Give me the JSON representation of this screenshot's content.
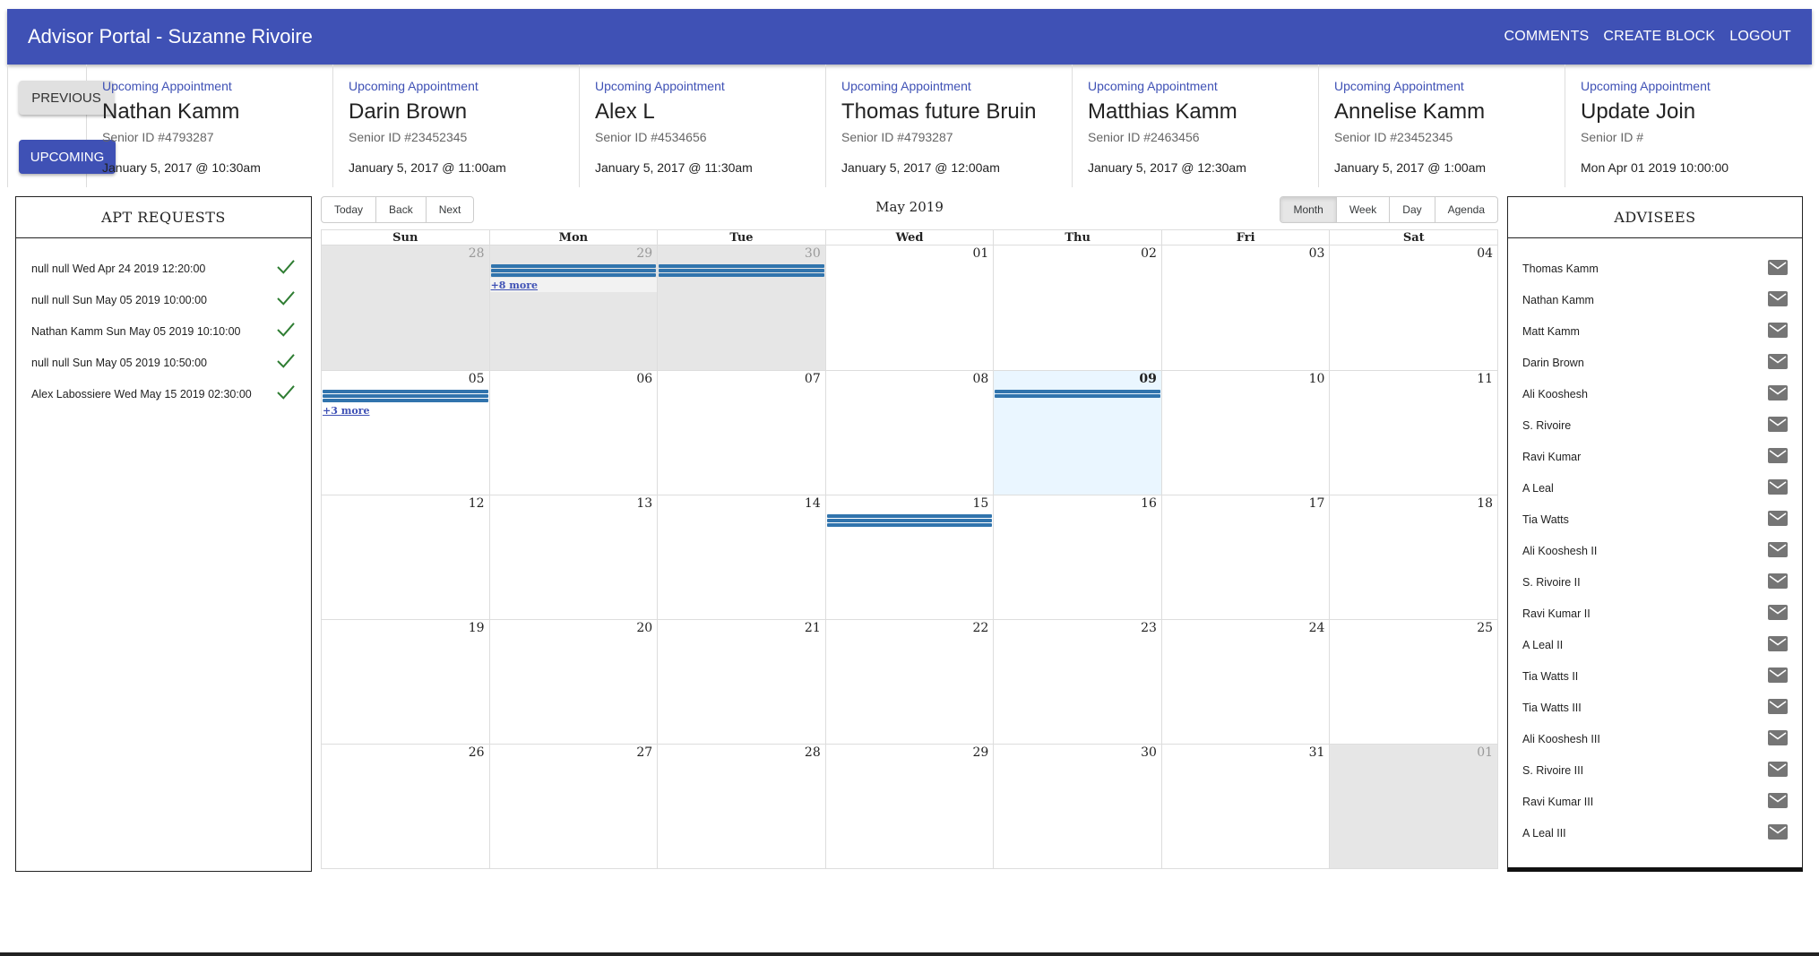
{
  "app": {
    "title": "Advisor Portal - Suzanne Rivoire",
    "actions": [
      "COMMENTS",
      "CREATE BLOCK",
      "LOGOUT"
    ]
  },
  "nav": {
    "previous": "PREVIOUS",
    "upcoming": "UPCOMING"
  },
  "appointments": [
    {
      "label": "Upcoming Appointment",
      "name": "Nathan Kamm",
      "senior_id": "Senior ID #4793287",
      "date": "January 5, 2017 @ 10:30am"
    },
    {
      "label": "Upcoming Appointment",
      "name": "Darin Brown",
      "senior_id": "Senior ID #23452345",
      "date": "January 5, 2017 @ 11:00am"
    },
    {
      "label": "Upcoming Appointment",
      "name": "Alex L",
      "senior_id": "Senior ID #4534656",
      "date": "January 5, 2017 @ 11:30am"
    },
    {
      "label": "Upcoming Appointment",
      "name": "Thomas future Bruin",
      "senior_id": "Senior ID #4793287",
      "date": "January 5, 2017 @ 12:00am"
    },
    {
      "label": "Upcoming Appointment",
      "name": "Matthias Kamm",
      "senior_id": "Senior ID #2463456",
      "date": "January 5, 2017 @ 12:30am"
    },
    {
      "label": "Upcoming Appointment",
      "name": "Annelise Kamm",
      "senior_id": "Senior ID #23452345",
      "date": "January 5, 2017 @ 1:00am"
    },
    {
      "label": "Upcoming Appointment",
      "name": "Update Join",
      "senior_id": "Senior ID #",
      "date": "Mon Apr 01 2019 10:00:00"
    }
  ],
  "requests": {
    "title": "APT REQUESTS",
    "items": [
      "null null Wed Apr 24 2019 12:20:00",
      "null null Sun May 05 2019 10:00:00",
      "Nathan Kamm Sun May 05 2019 10:10:00",
      "null null Sun May 05 2019 10:50:00",
      "Alex Labossiere Wed May 15 2019 02:30:00"
    ]
  },
  "calendar": {
    "label": "May 2019",
    "nav_buttons": [
      "Today",
      "Back",
      "Next"
    ],
    "view_buttons": [
      "Month",
      "Week",
      "Day",
      "Agenda"
    ],
    "active_view": "Month",
    "weekdays": [
      "Sun",
      "Mon",
      "Tue",
      "Wed",
      "Thu",
      "Fri",
      "Sat"
    ],
    "weeks": [
      [
        {
          "d": "28",
          "off": true
        },
        {
          "d": "29",
          "off": true,
          "events": 3,
          "more": "+8 more"
        },
        {
          "d": "30",
          "off": true,
          "events": 3
        },
        {
          "d": "01"
        },
        {
          "d": "02"
        },
        {
          "d": "03"
        },
        {
          "d": "04"
        }
      ],
      [
        {
          "d": "05",
          "events": 3,
          "more": "+3 more"
        },
        {
          "d": "06"
        },
        {
          "d": "07"
        },
        {
          "d": "08"
        },
        {
          "d": "09",
          "today": true,
          "events": 2
        },
        {
          "d": "10"
        },
        {
          "d": "11"
        }
      ],
      [
        {
          "d": "12"
        },
        {
          "d": "13"
        },
        {
          "d": "14"
        },
        {
          "d": "15",
          "events": 3
        },
        {
          "d": "16"
        },
        {
          "d": "17"
        },
        {
          "d": "18"
        }
      ],
      [
        {
          "d": "19"
        },
        {
          "d": "20"
        },
        {
          "d": "21"
        },
        {
          "d": "22"
        },
        {
          "d": "23"
        },
        {
          "d": "24"
        },
        {
          "d": "25"
        }
      ],
      [
        {
          "d": "26"
        },
        {
          "d": "27"
        },
        {
          "d": "28"
        },
        {
          "d": "29"
        },
        {
          "d": "30"
        },
        {
          "d": "31"
        },
        {
          "d": "01",
          "off": true
        }
      ]
    ],
    "event_color": "#3174ad",
    "today_color": "#eaf6ff"
  },
  "advisees": {
    "title": "ADVISEES",
    "items": [
      "Thomas Kamm",
      "Nathan Kamm",
      "Matt Kamm",
      "Darin Brown",
      "Ali Kooshesh",
      "S. Rivoire",
      "Ravi Kumar",
      "A Leal",
      "Tia Watts",
      "Ali Kooshesh II",
      "S. Rivoire II",
      "Ravi Kumar II",
      "A Leal II",
      "Tia Watts II",
      "Tia Watts III",
      "Ali Kooshesh III",
      "S. Rivoire III",
      "Ravi Kumar III",
      "A Leal III"
    ]
  },
  "colors": {
    "primary": "#3f51b5",
    "check": "#2e7d32",
    "mail_icon": "#757575"
  }
}
